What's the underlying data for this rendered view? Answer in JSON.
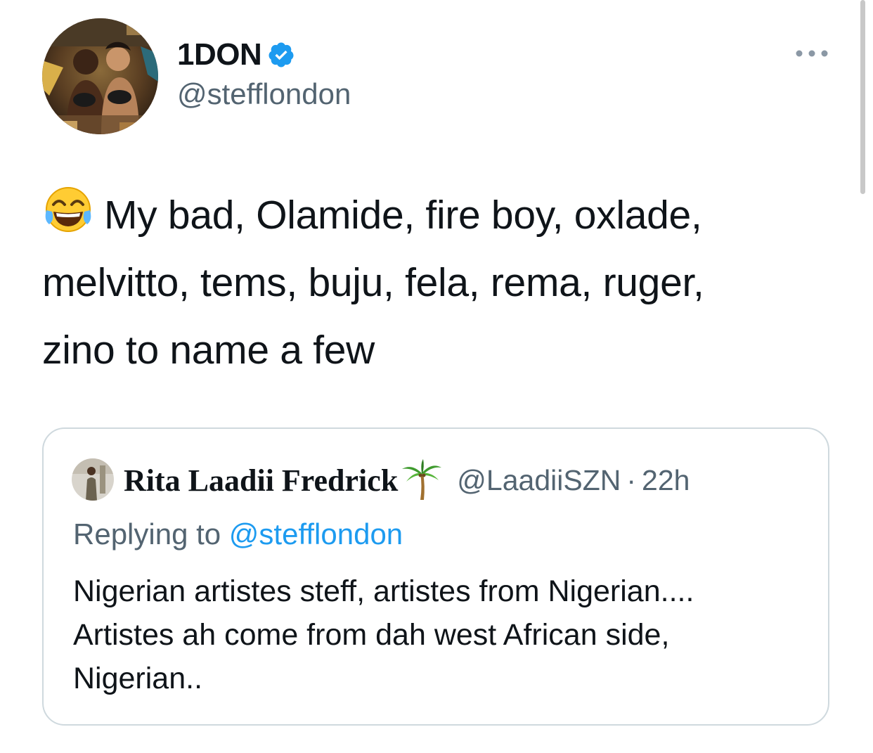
{
  "tweet": {
    "author": {
      "display_name": "1DON",
      "handle": "@stefflondon",
      "verified": true,
      "avatar_icon": "profile-photo",
      "verified_icon": "verified-badge-icon"
    },
    "more_icon": "more-options-icon",
    "emoji": "face-with-tears-of-joy",
    "text_lines": [
      "My bad, Olamide, fire boy, oxlade,",
      "melvitto, tems, buju, fela, rema, ruger,",
      "zino to name a few"
    ]
  },
  "quote": {
    "author": {
      "display_name": "Rita Laadii Fredrick",
      "name_emoji": "palm-tree",
      "handle": "@LaadiiSZN",
      "separator": "·",
      "time": "22h"
    },
    "replying_prefix": "Replying to",
    "replying_to": "@stefflondon",
    "text_lines": [
      "Nigerian artistes steff, artistes from Nigerian....",
      "Artistes ah come from dah west African side,",
      "Nigerian.."
    ]
  },
  "colors": {
    "text": "#0f1419",
    "secondary": "#536471",
    "accent": "#1d9bf0",
    "border": "#cfd9de"
  }
}
